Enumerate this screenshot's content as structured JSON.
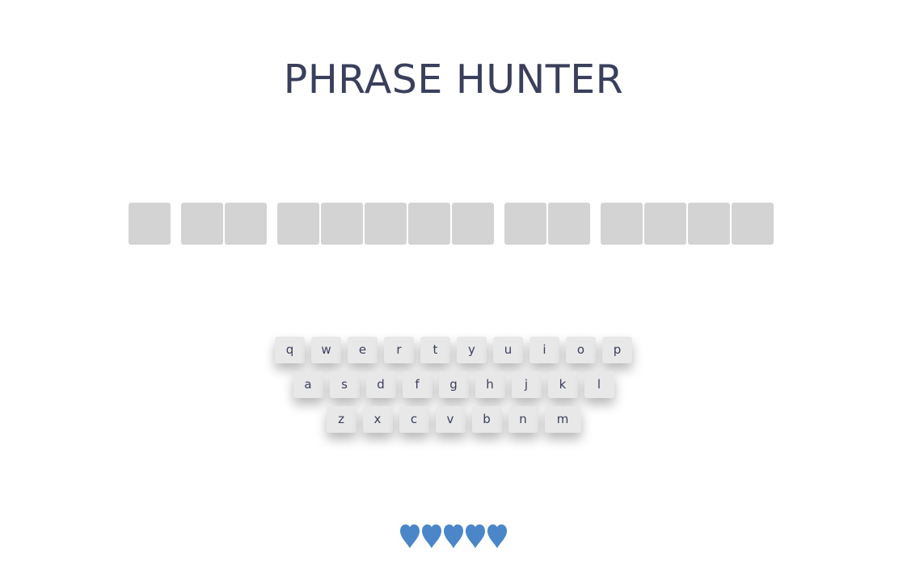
{
  "header": {
    "title": "PHRASE HUNTER"
  },
  "phrase": {
    "words": [
      {
        "length": 1
      },
      {
        "length": 2
      },
      {
        "length": 5
      },
      {
        "length": 2
      },
      {
        "length": 4
      }
    ],
    "hidden_tile_color": "#d3d3d3"
  },
  "keyboard": {
    "rows": [
      [
        "q",
        "w",
        "e",
        "r",
        "t",
        "y",
        "u",
        "i",
        "o",
        "p"
      ],
      [
        "a",
        "s",
        "d",
        "f",
        "g",
        "h",
        "j",
        "k",
        "l"
      ],
      [
        "z",
        "x",
        "c",
        "v",
        "b",
        "n",
        "m"
      ]
    ]
  },
  "scoreboard": {
    "lives": 5,
    "heart_icon": "heart-icon",
    "heart_color": "#4a86c8"
  },
  "colors": {
    "title": "#3a3f5c",
    "key_background": "#e8e8e8"
  }
}
